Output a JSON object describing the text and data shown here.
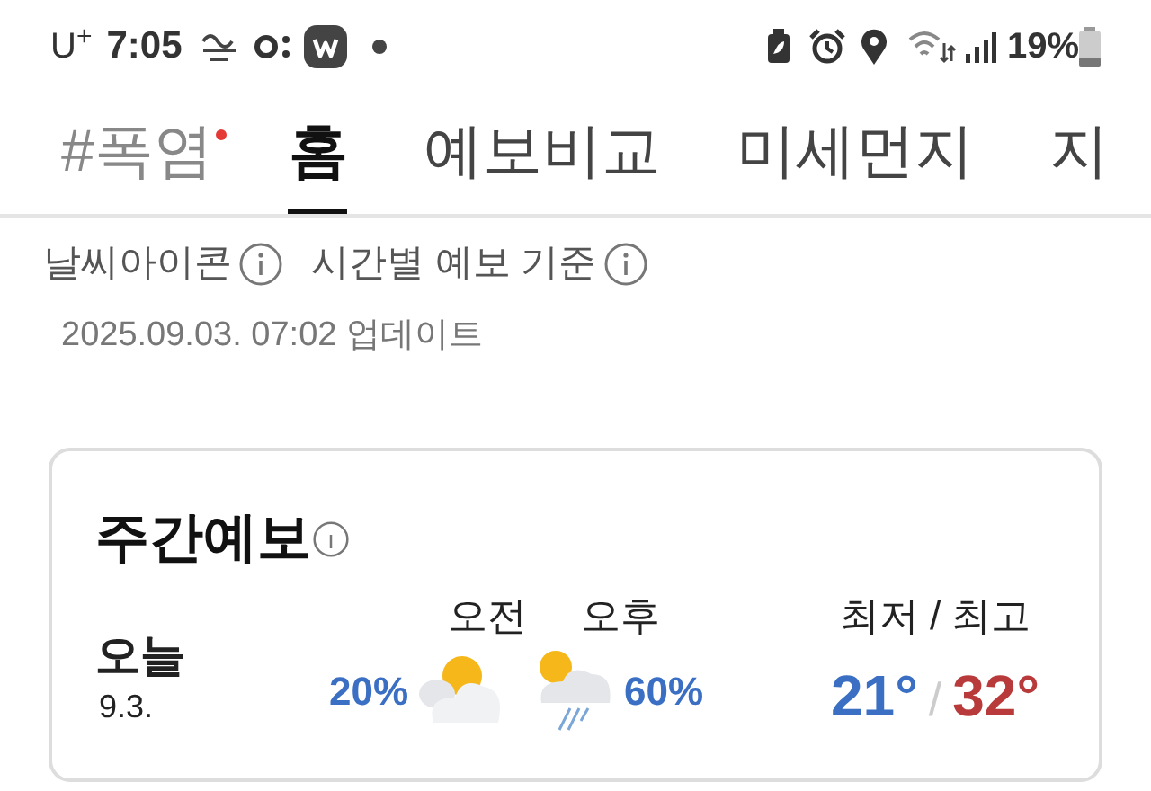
{
  "status_bar": {
    "carrier": "U$^{+}$",
    "time": "7:05",
    "battery_percent": "19%"
  },
  "tabs": [
    {
      "label": "#폭염",
      "kind": "hashtag",
      "new": true,
      "selected": false
    },
    {
      "label": "홈",
      "kind": "plain",
      "selected": true
    },
    {
      "label": "예보비교",
      "kind": "plain",
      "selected": false
    },
    {
      "label": "미세먼지",
      "kind": "plain",
      "selected": false
    },
    {
      "label": "지",
      "kind": "plain",
      "selected": false
    }
  ],
  "info_links": [
    "날씨아이콘",
    "시간별 예보 기준"
  ],
  "updated": "2025.09.03. 07:02 업데이트",
  "weekly_forecast": {
    "title": "주간예보",
    "headers": {
      "am": "오전",
      "pm": "오후",
      "temps": "최저 / 최고"
    },
    "days": [
      {
        "day": "오늘",
        "date": "9.3.",
        "am": {
          "rain_chance": "20%",
          "kind": "partly_cloudy"
        },
        "pm": {
          "rain_chance": "60%",
          "kind": "rain"
        },
        "low": "21°",
        "separator": "/",
        "high": "32°"
      }
    ]
  }
}
